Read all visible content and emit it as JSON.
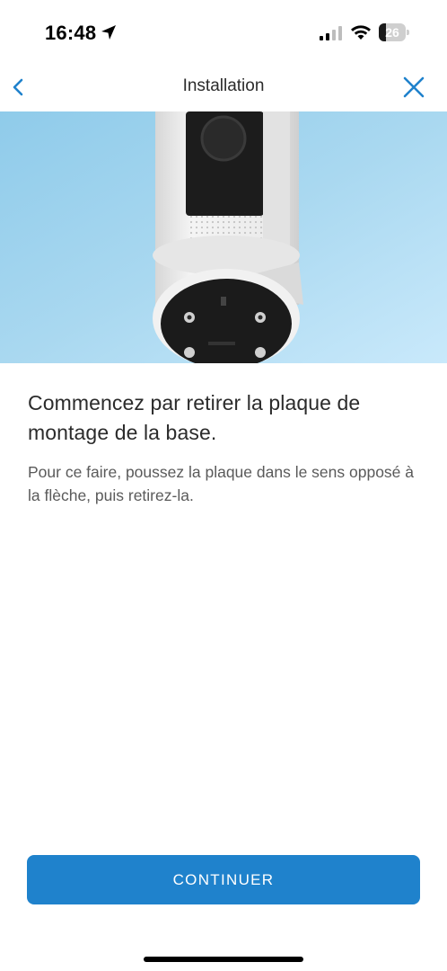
{
  "status_bar": {
    "time": "16:48",
    "battery_level": "26",
    "battery_fraction": 0.26,
    "icons": [
      "location-arrow-icon",
      "signal-icon",
      "wifi-icon",
      "battery-icon"
    ]
  },
  "nav": {
    "title": "Installation",
    "back_icon": "chevron-left-icon",
    "close_icon": "close-icon",
    "accent_color": "#1f82cc"
  },
  "hero": {
    "description_icon": "camera-base-illustration",
    "background_color": "#a9d8f0"
  },
  "content": {
    "heading": "Commencez par retirer la plaque de montage de la base.",
    "body": "Pour ce faire, poussez la plaque dans le sens opposé à la flèche, puis retirez-la."
  },
  "actions": {
    "continue_label": "CONTINUER",
    "button_color": "#1f82cc"
  }
}
